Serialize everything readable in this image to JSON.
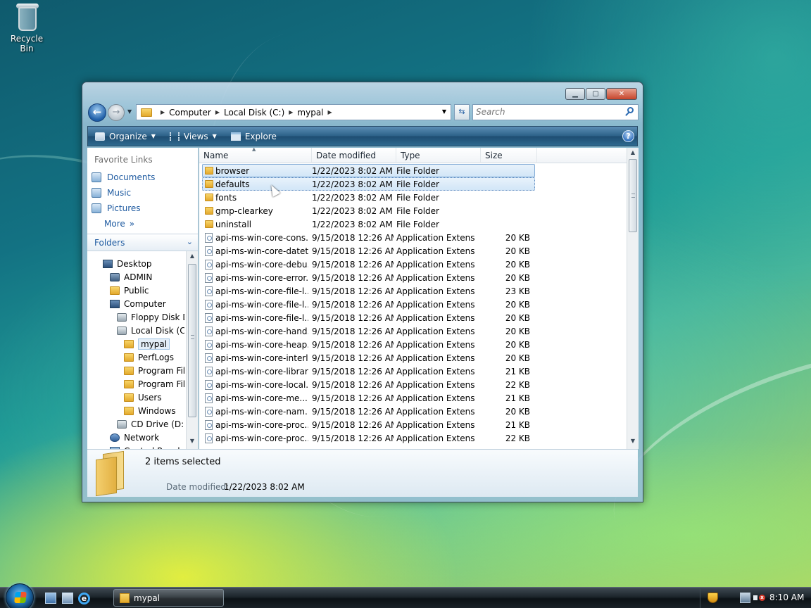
{
  "desktop": {
    "recycle_bin_label": "Recycle Bin"
  },
  "window": {
    "title": "mypal",
    "nav": {
      "back_glyph": "←",
      "forward_glyph": "→",
      "breadcrumb": [
        "Computer",
        "Local Disk (C:)",
        "mypal"
      ],
      "search_placeholder": "Search"
    },
    "toolbar": {
      "organize": "Organize",
      "views": "Views",
      "explore": "Explore",
      "help": "?"
    },
    "favorite_links": {
      "header": "Favorite Links",
      "items": [
        "Documents",
        "Music",
        "Pictures"
      ],
      "more": "More"
    },
    "folders": {
      "header": "Folders",
      "tree": [
        {
          "label": "Desktop",
          "icon": "desktop-icon"
        },
        {
          "label": "ADMIN",
          "icon": "user-icon"
        },
        {
          "label": "Public",
          "icon": "folder-icon"
        },
        {
          "label": "Computer",
          "icon": "computer-icon"
        },
        {
          "label": "Floppy Disk Dr",
          "icon": "floppy-icon"
        },
        {
          "label": "Local Disk (C:)",
          "icon": "drive-icon"
        },
        {
          "label": "mypal",
          "icon": "folder-icon",
          "selected": true
        },
        {
          "label": "PerfLogs",
          "icon": "folder-icon"
        },
        {
          "label": "Program File",
          "icon": "folder-icon"
        },
        {
          "label": "Program File",
          "icon": "folder-icon"
        },
        {
          "label": "Users",
          "icon": "folder-icon"
        },
        {
          "label": "Windows",
          "icon": "folder-icon"
        },
        {
          "label": "CD Drive (D:) M",
          "icon": "cd-drive-icon"
        },
        {
          "label": "Network",
          "icon": "network-icon"
        },
        {
          "label": "Control Panel",
          "icon": "control-panel-icon"
        }
      ]
    },
    "columns": [
      "Name",
      "Date modified",
      "Type",
      "Size"
    ],
    "files": [
      {
        "name": "browser",
        "date": "1/22/2023 8:02 AM",
        "type": "File Folder",
        "size": "",
        "kind": "folder",
        "selected": true
      },
      {
        "name": "defaults",
        "date": "1/22/2023 8:02 AM",
        "type": "File Folder",
        "size": "",
        "kind": "folder",
        "selected": true,
        "focused": true
      },
      {
        "name": "fonts",
        "date": "1/22/2023 8:02 AM",
        "type": "File Folder",
        "size": "",
        "kind": "folder"
      },
      {
        "name": "gmp-clearkey",
        "date": "1/22/2023 8:02 AM",
        "type": "File Folder",
        "size": "",
        "kind": "folder"
      },
      {
        "name": "uninstall",
        "date": "1/22/2023 8:02 AM",
        "type": "File Folder",
        "size": "",
        "kind": "folder"
      },
      {
        "name": "api-ms-win-core-cons...",
        "date": "9/15/2018 12:26 AM",
        "type": "Application Extens...",
        "size": "20 KB",
        "kind": "dll"
      },
      {
        "name": "api-ms-win-core-datet...",
        "date": "9/15/2018 12:26 AM",
        "type": "Application Extens...",
        "size": "20 KB",
        "kind": "dll"
      },
      {
        "name": "api-ms-win-core-debu...",
        "date": "9/15/2018 12:26 AM",
        "type": "Application Extens...",
        "size": "20 KB",
        "kind": "dll"
      },
      {
        "name": "api-ms-win-core-error...",
        "date": "9/15/2018 12:26 AM",
        "type": "Application Extens...",
        "size": "20 KB",
        "kind": "dll"
      },
      {
        "name": "api-ms-win-core-file-l...",
        "date": "9/15/2018 12:26 AM",
        "type": "Application Extens...",
        "size": "23 KB",
        "kind": "dll"
      },
      {
        "name": "api-ms-win-core-file-l...",
        "date": "9/15/2018 12:26 AM",
        "type": "Application Extens...",
        "size": "20 KB",
        "kind": "dll"
      },
      {
        "name": "api-ms-win-core-file-l...",
        "date": "9/15/2018 12:26 AM",
        "type": "Application Extens...",
        "size": "20 KB",
        "kind": "dll"
      },
      {
        "name": "api-ms-win-core-hand...",
        "date": "9/15/2018 12:26 AM",
        "type": "Application Extens...",
        "size": "20 KB",
        "kind": "dll"
      },
      {
        "name": "api-ms-win-core-heap...",
        "date": "9/15/2018 12:26 AM",
        "type": "Application Extens...",
        "size": "20 KB",
        "kind": "dll"
      },
      {
        "name": "api-ms-win-core-interl...",
        "date": "9/15/2018 12:26 AM",
        "type": "Application Extens...",
        "size": "20 KB",
        "kind": "dll"
      },
      {
        "name": "api-ms-win-core-librar...",
        "date": "9/15/2018 12:26 AM",
        "type": "Application Extens...",
        "size": "21 KB",
        "kind": "dll"
      },
      {
        "name": "api-ms-win-core-local...",
        "date": "9/15/2018 12:26 AM",
        "type": "Application Extens...",
        "size": "22 KB",
        "kind": "dll"
      },
      {
        "name": "api-ms-win-core-me...",
        "date": "9/15/2018 12:26 AM",
        "type": "Application Extens...",
        "size": "21 KB",
        "kind": "dll"
      },
      {
        "name": "api-ms-win-core-nam...",
        "date": "9/15/2018 12:26 AM",
        "type": "Application Extens...",
        "size": "20 KB",
        "kind": "dll"
      },
      {
        "name": "api-ms-win-core-proc...",
        "date": "9/15/2018 12:26 AM",
        "type": "Application Extens...",
        "size": "21 KB",
        "kind": "dll"
      },
      {
        "name": "api-ms-win-core-proc...",
        "date": "9/15/2018 12:26 AM",
        "type": "Application Extens...",
        "size": "22 KB",
        "kind": "dll"
      }
    ],
    "details": {
      "count": "2 items selected",
      "date_label": "Date modified:",
      "date_value": "1/22/2023 8:02 AM"
    }
  },
  "taskbar": {
    "task_label": "mypal",
    "clock": "8:10 AM",
    "ie_glyph": "e"
  }
}
